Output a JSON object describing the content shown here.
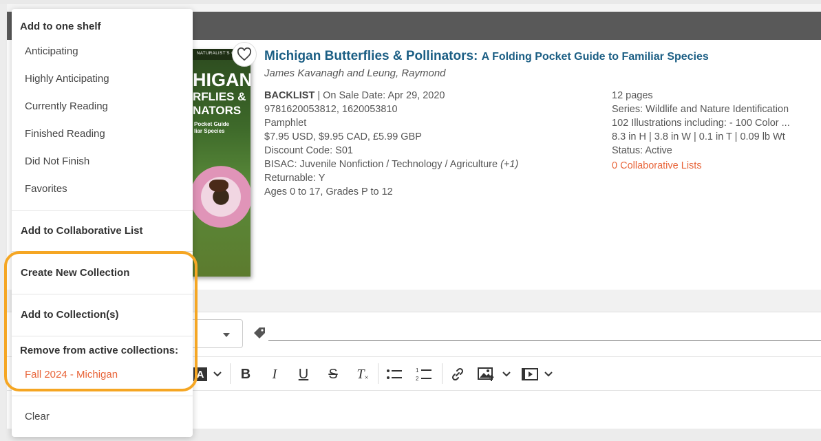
{
  "book": {
    "cover_band": "NATURALIST'S GUIDE",
    "cover_line1": "HIGAN",
    "cover_line2": "RFLIES &",
    "cover_line3": "NATORS",
    "cover_line4a": "Pocket Guide",
    "cover_line4b": "liar Species",
    "title_main": "Michigan Butterflies & Pollinators:",
    "title_sub": "A Folding Pocket Guide to Familiar Species",
    "author": "James Kavanagh and Leung, Raymond"
  },
  "details_left": {
    "status_label": "BACKLIST",
    "on_sale": " | On Sale Date: Apr 29, 2020",
    "isbn": "9781620053812, 1620053810",
    "format": "Pamphlet",
    "price": "$7.95 USD, $9.95 CAD, £5.99 GBP",
    "discount": "Discount Code: S01",
    "bisac": "BISAC: Juvenile Nonfiction / Technology / Agriculture ",
    "bisac_more": "(+1)",
    "returnable": "Returnable: Y",
    "ages": "Ages 0 to 17, Grades P to 12"
  },
  "details_right": {
    "pages": "12 pages",
    "series": "Series: Wildlife and Nature Identification",
    "illustrations": "102 Illustrations including: - 100 Color ...",
    "dimensions": "8.3 in H | 3.8 in W | 0.1 in T | 0.09 lb Wt",
    "status": "Status: Active",
    "collab_lists": "0 Collaborative Lists"
  },
  "menu": {
    "header_shelf": "Add to one shelf",
    "shelves": [
      "Anticipating",
      "Highly Anticipating",
      "Currently Reading",
      "Finished Reading",
      "Did Not Finish",
      "Favorites"
    ],
    "add_collab": "Add to Collaborative List",
    "create_collection": "Create New Collection",
    "add_collection": "Add to Collection(s)",
    "remove_header": "Remove from active collections:",
    "active_collection": "Fall 2024 - Michigan",
    "clear": "Clear"
  },
  "toolbar": {
    "font_color_glyph": "A",
    "bold": "B",
    "italic": "I",
    "underline": "U",
    "strike": "S",
    "clear_format": "T"
  },
  "colors": {
    "accent_orange": "#e8653a",
    "title_blue": "#1b5e84",
    "highlight": "#f5a623"
  }
}
